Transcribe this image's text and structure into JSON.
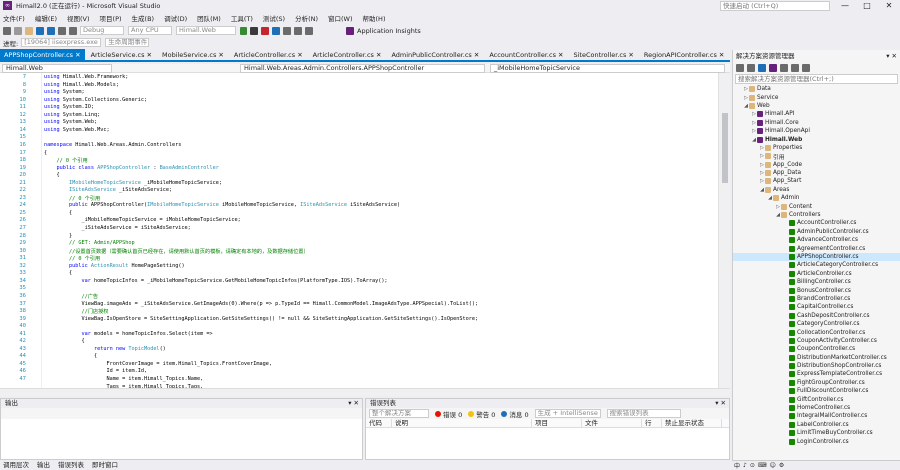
{
  "window": {
    "title": "Himall2.0 (正在运行) - Microsoft Visual Studio",
    "quick_launch": "快速启动 (Ctrl+Q)"
  },
  "menu": [
    "文件(F)",
    "编辑(E)",
    "视图(V)",
    "项目(P)",
    "生成(B)",
    "调试(D)",
    "团队(M)",
    "工具(T)",
    "测试(S)",
    "分析(N)",
    "窗口(W)",
    "帮助(H)"
  ],
  "toolbar": {
    "config": "Debug",
    "platform": "Any CPU",
    "project": "Himall.Web",
    "insights": "Application Insights",
    "process": "[19064] iisexpress.exe",
    "lifecycle": "生命周期事件"
  },
  "tabs": [
    "APPShopController.cs",
    "ArticleService.cs",
    "MobileService.cs",
    "ArticleController.cs",
    "ArticleController.cs",
    "AdminPublicController.cs",
    "AccountController.cs",
    "SiteController.cs",
    "RegionAPIController.cs"
  ],
  "navbar": {
    "project": "Himall.Web",
    "class": "Himall.Web.Areas.Admin.Controllers.APPShopController",
    "member": "_iMobileHomeTopicService"
  },
  "code": {
    "line_numbers": [
      7,
      8,
      9,
      10,
      11,
      12,
      13,
      14,
      15,
      16,
      17,
      18,
      19,
      20,
      21,
      22,
      23,
      24,
      25,
      26,
      27,
      28,
      29,
      30,
      31,
      32,
      33,
      34,
      35,
      36,
      37,
      38,
      39,
      40,
      41,
      42,
      43,
      44,
      45,
      46,
      47
    ],
    "lines": [
      [
        [
          "kw",
          "using "
        ],
        [
          "",
          "Himall.Web.Framework;"
        ]
      ],
      [
        [
          "kw",
          "using "
        ],
        [
          "",
          "Himall.Web.Models;"
        ]
      ],
      [
        [
          "kw",
          "using "
        ],
        [
          "",
          "System;"
        ]
      ],
      [
        [
          "kw",
          "using "
        ],
        [
          "",
          "System.Collections.Generic;"
        ]
      ],
      [
        [
          "kw",
          "using "
        ],
        [
          "",
          "System.IO;"
        ]
      ],
      [
        [
          "kw",
          "using "
        ],
        [
          "",
          "System.Linq;"
        ]
      ],
      [
        [
          "kw",
          "using "
        ],
        [
          "",
          "System.Web;"
        ]
      ],
      [
        [
          "kw",
          "using "
        ],
        [
          "",
          "System.Web.Mvc;"
        ]
      ],
      [
        [
          "",
          ""
        ]
      ],
      [
        [
          "kw",
          "namespace "
        ],
        [
          "",
          "Himall.Web.Areas.Admin.Controllers"
        ]
      ],
      [
        [
          "",
          "{"
        ]
      ],
      [
        [
          "cm",
          "    // 0 个引用"
        ]
      ],
      [
        [
          "kw",
          "    public class "
        ],
        [
          "ty",
          "APPShopController "
        ],
        [
          "",
          ": "
        ],
        [
          "ty",
          "BaseAdminController"
        ]
      ],
      [
        [
          "",
          "    {"
        ]
      ],
      [
        [
          "ty",
          "        IMobileHomeTopicService "
        ],
        [
          "",
          "_iMobileHomeTopicService;"
        ]
      ],
      [
        [
          "ty",
          "        ISiteAdsService "
        ],
        [
          "",
          "_iSiteAdsService;"
        ]
      ],
      [
        [
          "cm",
          "        // 0 个引用"
        ]
      ],
      [
        [
          "kw",
          "        public "
        ],
        [
          "",
          "APPShopController("
        ],
        [
          "ty",
          "IMobileHomeTopicService "
        ],
        [
          "",
          "iMobileHomeTopicService, "
        ],
        [
          "ty",
          "ISiteAdsService "
        ],
        [
          "",
          "iSiteAdsService)"
        ]
      ],
      [
        [
          "",
          "        {"
        ]
      ],
      [
        [
          "",
          "            _iMobileHomeTopicService = iMobileHomeTopicService;"
        ]
      ],
      [
        [
          "",
          "            _iSiteAdsService = iSiteAdsService;"
        ]
      ],
      [
        [
          "",
          "        }"
        ]
      ],
      [
        [
          "cm",
          "        // GET: Admin/APPShop"
        ]
      ],
      [
        [
          "cm",
          "        //设置首页数据（需要确认首页已经存在，请使用默认首页的模板，请确定有本地的，及数据存储位置）"
        ]
      ],
      [
        [
          "cm",
          "        // 0 个引用"
        ]
      ],
      [
        [
          "kw",
          "        public "
        ],
        [
          "ty",
          "ActionResult "
        ],
        [
          "",
          "HomePageSetting()"
        ]
      ],
      [
        [
          "",
          "        {"
        ]
      ],
      [
        [
          "kw",
          "            var "
        ],
        [
          "",
          "homeTopicInfos = _iMobileHomeTopicService.GetMobileHomeTopicInfos(PlatformType.IOS).ToArray();"
        ]
      ],
      [
        [
          "",
          ""
        ]
      ],
      [
        [
          "cm",
          "            //广告"
        ]
      ],
      [
        [
          "",
          "            ViewBag.imageAds = _iSiteAdsService.GetImageAds(0).Where(p => p.TypeId == Himall.CommonModel.ImageAdsType.APPSpecial).ToList();"
        ]
      ],
      [
        [
          "cm",
          "            //门店授权"
        ]
      ],
      [
        [
          "",
          "            ViewBag.IsOpenStore = SiteSettingApplication.GetSiteSettings() != null && SiteSettingApplication.GetSiteSettings().IsOpenStore;"
        ]
      ],
      [
        [
          "",
          ""
        ]
      ],
      [
        [
          "kw",
          "            var "
        ],
        [
          "",
          "models = homeTopicInfos.Select(item =>"
        ]
      ],
      [
        [
          "",
          "            {"
        ]
      ],
      [
        [
          "kw",
          "                return new "
        ],
        [
          "ty",
          "TopicModel"
        ],
        [
          "",
          "()"
        ]
      ],
      [
        [
          "",
          "                {"
        ]
      ],
      [
        [
          "",
          "                    FrontCoverImage = item.Himall_Topics.FrontCoverImage,"
        ]
      ],
      [
        [
          "",
          "                    Id = item.Id,"
        ]
      ],
      [
        [
          "",
          "                    Name = item.Himall_Topics.Name,"
        ]
      ],
      [
        [
          "",
          "                    Tags = item.Himall_Topics.Tags,"
        ]
      ]
    ]
  },
  "output_panel": {
    "title": "输出",
    "pin": "▾ ✕"
  },
  "error_panel": {
    "title": "错误列表",
    "scope": "整个解决方案",
    "errors": "错误 0",
    "warnings": "警告 0",
    "messages": "消息 0",
    "build": "生成 + IntelliSense",
    "search": "搜索错误列表",
    "columns": [
      "代码",
      "说明",
      "项目",
      "文件",
      "行",
      "禁止显示状态"
    ]
  },
  "bottom_tabs": [
    "调用层次",
    "输出",
    "错误列表",
    "即时窗口"
  ],
  "solution_explorer": {
    "title": "解决方案资源管理器",
    "search": "搜索解决方案资源管理器(Ctrl+;)",
    "items": [
      {
        "label": "Data",
        "indent": 1,
        "kind": "folder",
        "open": false
      },
      {
        "label": "Service",
        "indent": 1,
        "kind": "folder",
        "open": false
      },
      {
        "label": "Web",
        "indent": 1,
        "kind": "folder",
        "open": true
      },
      {
        "label": "Himall.API",
        "indent": 2,
        "kind": "proj",
        "open": false
      },
      {
        "label": "Himall.Core",
        "indent": 2,
        "kind": "proj",
        "open": false
      },
      {
        "label": "Himall.OpenApi",
        "indent": 2,
        "kind": "proj",
        "open": false
      },
      {
        "label": "Himall.Web",
        "indent": 2,
        "kind": "proj",
        "open": true
      },
      {
        "label": "Properties",
        "indent": 3,
        "kind": "folder",
        "open": false
      },
      {
        "label": "引用",
        "indent": 3,
        "kind": "folder",
        "open": false
      },
      {
        "label": "App_Code",
        "indent": 3,
        "kind": "folder",
        "open": false
      },
      {
        "label": "App_Data",
        "indent": 3,
        "kind": "folder",
        "open": false
      },
      {
        "label": "App_Start",
        "indent": 3,
        "kind": "folder",
        "open": false
      },
      {
        "label": "Areas",
        "indent": 3,
        "kind": "folder",
        "open": true
      },
      {
        "label": "Admin",
        "indent": 4,
        "kind": "folder",
        "open": true
      },
      {
        "label": "Content",
        "indent": 5,
        "kind": "folder",
        "open": false
      },
      {
        "label": "Controllers",
        "indent": 5,
        "kind": "folder",
        "open": true
      },
      {
        "label": "AccountController.cs",
        "indent": 6,
        "kind": "cs"
      },
      {
        "label": "AdminPublicController.cs",
        "indent": 6,
        "kind": "cs"
      },
      {
        "label": "AdvanceController.cs",
        "indent": 6,
        "kind": "cs"
      },
      {
        "label": "AgreementController.cs",
        "indent": 6,
        "kind": "cs"
      },
      {
        "label": "APPShopController.cs",
        "indent": 6,
        "kind": "cs",
        "selected": true
      },
      {
        "label": "ArticleCategoryController.cs",
        "indent": 6,
        "kind": "cs"
      },
      {
        "label": "ArticleController.cs",
        "indent": 6,
        "kind": "cs"
      },
      {
        "label": "BillingController.cs",
        "indent": 6,
        "kind": "cs"
      },
      {
        "label": "BonusController.cs",
        "indent": 6,
        "kind": "cs"
      },
      {
        "label": "BrandController.cs",
        "indent": 6,
        "kind": "cs"
      },
      {
        "label": "CapitalController.cs",
        "indent": 6,
        "kind": "cs"
      },
      {
        "label": "CashDepositController.cs",
        "indent": 6,
        "kind": "cs"
      },
      {
        "label": "CategoryController.cs",
        "indent": 6,
        "kind": "cs"
      },
      {
        "label": "CollocationController.cs",
        "indent": 6,
        "kind": "cs"
      },
      {
        "label": "CouponActivityController.cs",
        "indent": 6,
        "kind": "cs"
      },
      {
        "label": "CouponController.cs",
        "indent": 6,
        "kind": "cs"
      },
      {
        "label": "DistributionMarketController.cs",
        "indent": 6,
        "kind": "cs"
      },
      {
        "label": "DistributionShopController.cs",
        "indent": 6,
        "kind": "cs"
      },
      {
        "label": "ExpressTemplateController.cs",
        "indent": 6,
        "kind": "cs"
      },
      {
        "label": "FightGroupController.cs",
        "indent": 6,
        "kind": "cs"
      },
      {
        "label": "FullDiscountController.cs",
        "indent": 6,
        "kind": "cs"
      },
      {
        "label": "GiftController.cs",
        "indent": 6,
        "kind": "cs"
      },
      {
        "label": "HomeController.cs",
        "indent": 6,
        "kind": "cs"
      },
      {
        "label": "IntegralMallController.cs",
        "indent": 6,
        "kind": "cs"
      },
      {
        "label": "LabelController.cs",
        "indent": 6,
        "kind": "cs"
      },
      {
        "label": "LimitTimeBuyController.cs",
        "indent": 6,
        "kind": "cs"
      },
      {
        "label": "LoginController.cs",
        "indent": 6,
        "kind": "cs"
      }
    ]
  },
  "taskbar": [
    "中",
    "♪",
    "⊙",
    "⌨",
    "☺",
    "⚙"
  ],
  "colors": {
    "accent": "#007acc",
    "vs_purple": "#68217a",
    "selected": "#cce8ff"
  }
}
